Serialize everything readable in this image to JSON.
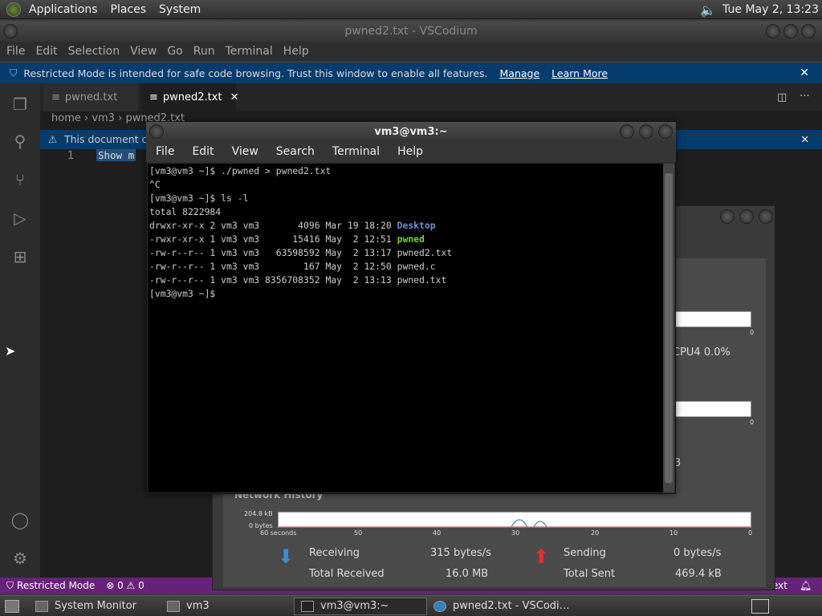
{
  "top_panel": {
    "menus": [
      "Applications",
      "Places",
      "System"
    ],
    "clock": "Tue May  2, 13:23"
  },
  "vscode": {
    "title": "pwned2.txt - VSCodium",
    "menu": [
      "File",
      "Edit",
      "Selection",
      "View",
      "Go",
      "Run",
      "Terminal",
      "Help"
    ],
    "banner": {
      "text": "Restricted Mode is intended for safe code browsing. Trust this window to enable all features.",
      "manage": "Manage",
      "learn_more": "Learn More"
    },
    "tabs": [
      {
        "label": "pwned.txt"
      },
      {
        "label": "pwned2.txt"
      }
    ],
    "breadcrumb": [
      "home",
      "vm3",
      "pwned2.txt"
    ],
    "doc_banner": "This document con",
    "line_number": "1",
    "line_text": "Show m",
    "status": {
      "restricted": "Restricted Mode",
      "problems": "⊗ 0 ⚠ 0",
      "right_text": "ext"
    }
  },
  "terminal": {
    "title": "vm3@vm3:~",
    "menu": [
      "File",
      "Edit",
      "View",
      "Search",
      "Terminal",
      "Help"
    ],
    "lines": [
      {
        "text": "[vm3@vm3 ~]$ ./pwned > pwned2.txt"
      },
      {
        "text": "^C"
      },
      {
        "text": "[vm3@vm3 ~]$ ls -l"
      },
      {
        "text": "total 8222984"
      },
      {
        "text": "drwxr-xr-x 2 vm3 vm3       4096 Mar 19 18:20 ",
        "name": "Desktop",
        "kind": "dir"
      },
      {
        "text": "-rwxr-xr-x 1 vm3 vm3      15416 May  2 12:51 ",
        "name": "pwned",
        "kind": "exe"
      },
      {
        "text": "-rw-r--r-- 1 vm3 vm3   63598592 May  2 13:17 ",
        "name": "pwned2.txt",
        "kind": "file"
      },
      {
        "text": "-rw-r--r-- 1 vm3 vm3        167 May  2 12:50 ",
        "name": "pwned.c",
        "kind": "file"
      },
      {
        "text": "-rw-r--r-- 1 vm3 vm3 8356708352 May  2 13:13 ",
        "name": "pwned.txt",
        "kind": "file"
      },
      {
        "text": "[vm3@vm3 ~]$ "
      }
    ]
  },
  "sysmon": {
    "cpu_label": "CPU4  0.0%",
    "cpu_axis_zero": "0",
    "mem_axis_zero": "0",
    "partial_digit": "3",
    "network_title": "Network History",
    "net_y_top": "204.8 kB",
    "net_y_bottom": "0 bytes",
    "net_x_labels": [
      "60 seconds",
      "50",
      "40",
      "30",
      "20",
      "10",
      "0"
    ],
    "receiving_label": "Receiving",
    "receiving_value": "315 bytes/s",
    "total_received_label": "Total Received",
    "total_received_value": "16.0 MB",
    "sending_label": "Sending",
    "sending_value": "0 bytes/s",
    "total_sent_label": "Total Sent",
    "total_sent_value": "469.4 kB"
  },
  "taskbar": [
    {
      "label": "System Monitor"
    },
    {
      "label": "vm3"
    },
    {
      "label": "vm3@vm3:~"
    },
    {
      "label": "pwned2.txt - VSCodi…"
    }
  ]
}
